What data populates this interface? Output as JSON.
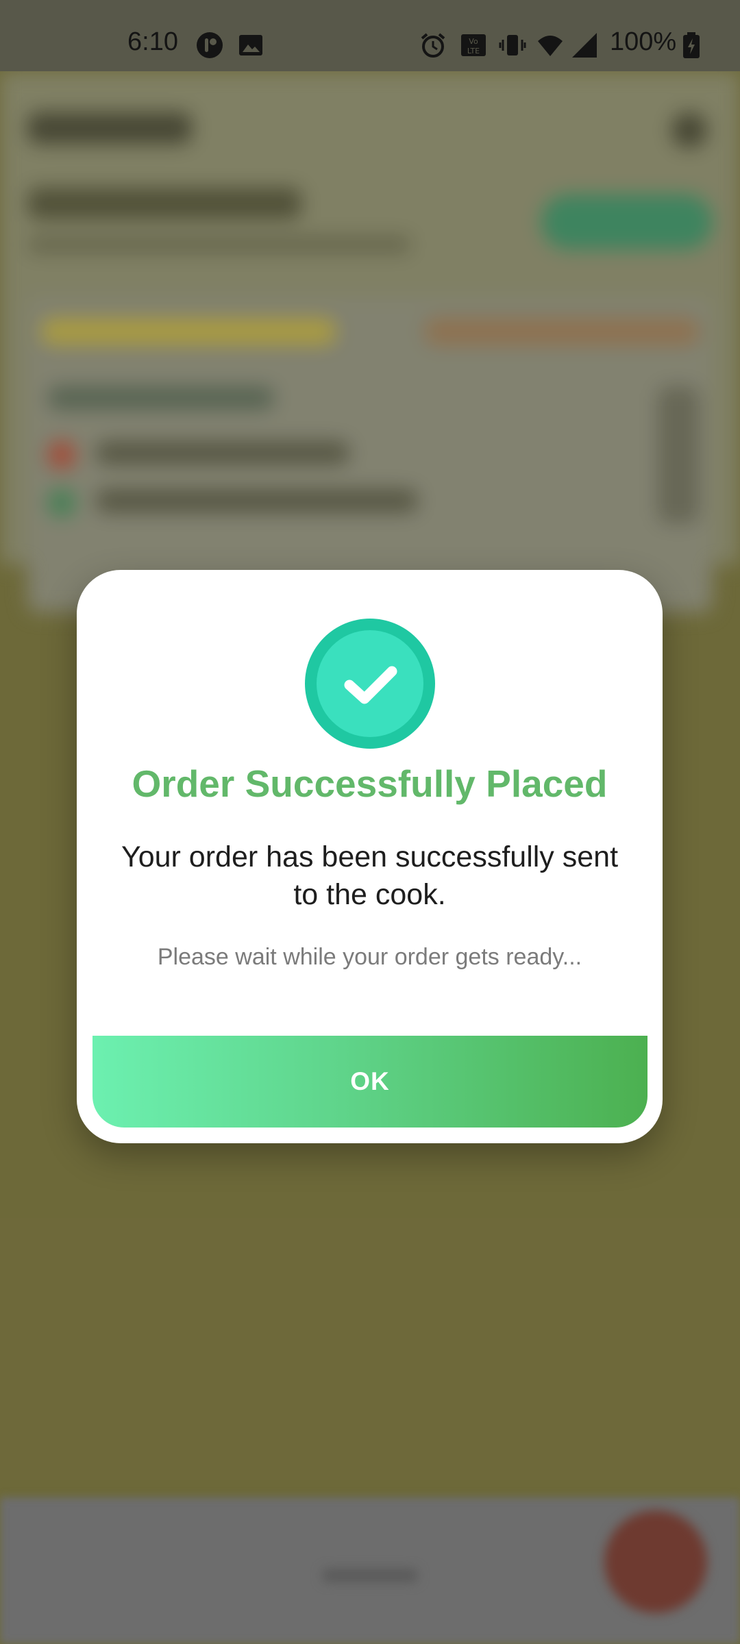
{
  "status_bar": {
    "time": "6:10",
    "battery": "100%",
    "icons_left": [
      "app-notification-icon",
      "image-icon"
    ],
    "icons_right": [
      "alarm-icon",
      "volte-icon",
      "vibrate-icon",
      "wifi-icon",
      "cell-signal-icon",
      "battery-charging-icon"
    ]
  },
  "dialog": {
    "icon": "check-circle-icon",
    "title": "Order Successfully Placed",
    "message": "Your order has been successfully sent to the cook.",
    "sub_message": "Please wait while your order gets ready...",
    "ok_label": "OK"
  },
  "colors": {
    "title": "#62b86a",
    "check_outer": "#1fc8a2",
    "check_inner": "#3ae0be",
    "button_gradient_start": "#6cf0b0",
    "button_gradient_end": "#4cb050",
    "backdrop": "#75703f"
  }
}
